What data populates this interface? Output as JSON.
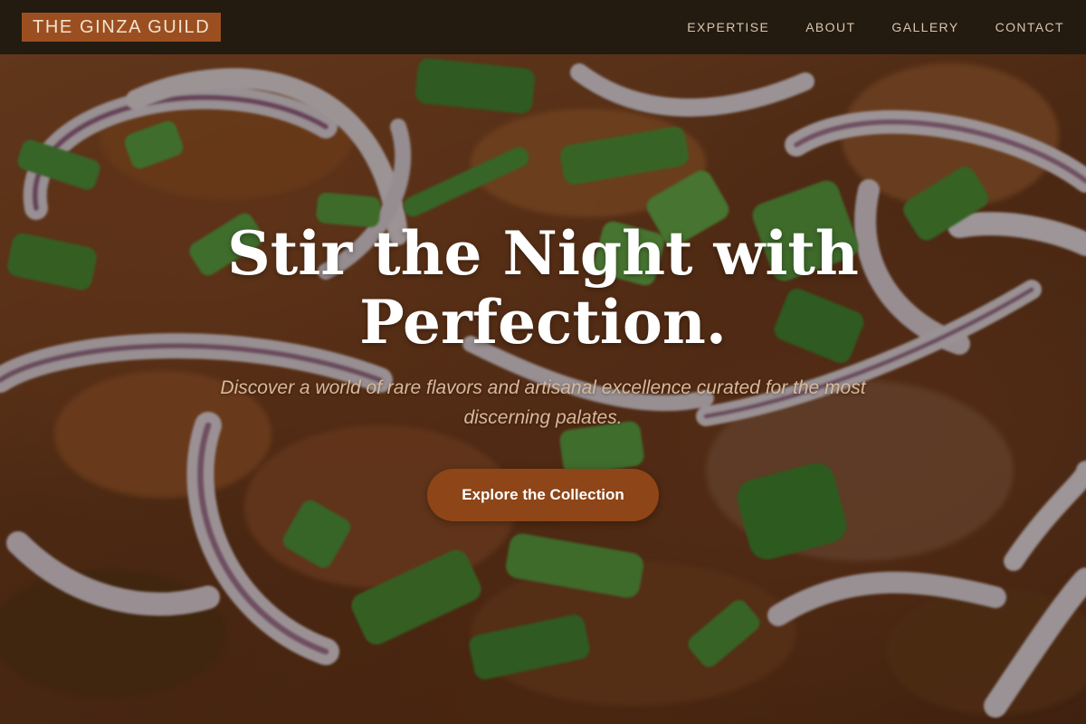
{
  "brand": {
    "name": "THE GINZA GUILD"
  },
  "nav": {
    "links": [
      {
        "label": "EXPERTISE"
      },
      {
        "label": "ABOUT"
      },
      {
        "label": "GALLERY"
      },
      {
        "label": "CONTACT"
      }
    ]
  },
  "hero": {
    "title": "Stir the Night with Perfection.",
    "subtitle": "Discover a world of rare flavors and artisanal excellence curated for the most discerning palates.",
    "cta_label": "Explore the Collection"
  },
  "colors": {
    "nav_background": "#231a10",
    "brand_background": "#9b4f20",
    "cta_background": "#8e4517",
    "subtitle_text": "#d9b89a"
  }
}
